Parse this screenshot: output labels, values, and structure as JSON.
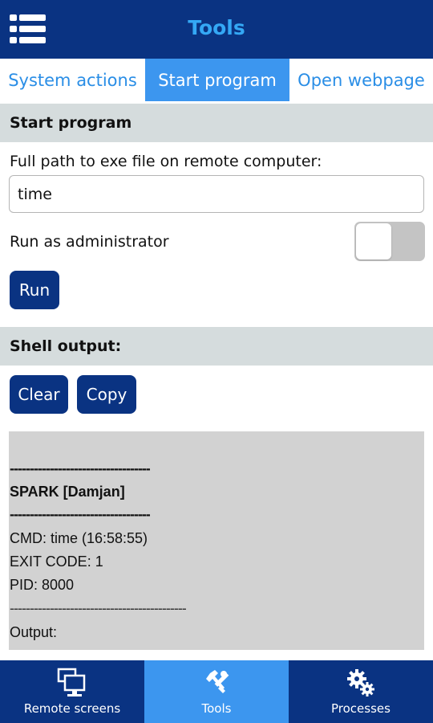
{
  "header": {
    "title": "Tools",
    "menu_icon": "hamburger-list-icon",
    "color": "#0a3382",
    "title_color": "#34a8f5"
  },
  "tabs": [
    {
      "label": "System actions",
      "active": false
    },
    {
      "label": "Start program",
      "active": true
    },
    {
      "label": "Open webpage",
      "active": false
    }
  ],
  "start_program": {
    "section_title": "Start program",
    "path_label": "Full path to exe file on remote computer:",
    "path_value": "time",
    "admin_label": "Run as administrator",
    "admin_enabled": false,
    "run_label": "Run"
  },
  "shell": {
    "section_title": "Shell output:",
    "clear_label": "Clear",
    "copy_label": "Copy",
    "lines": {
      "sep1": "-----------------------------------",
      "host": "SPARK [Damjan]",
      "sep2": "-----------------------------------",
      "cmd": "CMD: time (16:58:55)",
      "exit": "EXIT CODE: 1",
      "pid": "PID: 8000",
      "sep3": "--------------------------------------------",
      "output": "Output:"
    }
  },
  "bottom_nav": [
    {
      "label": "Remote screens",
      "icon": "monitors-icon",
      "active": false
    },
    {
      "label": "Tools",
      "icon": "tools-icon",
      "active": true
    },
    {
      "label": "Processes",
      "icon": "gears-icon",
      "active": false
    }
  ],
  "colors": {
    "primary": "#0a3382",
    "accent": "#3c96ef",
    "section_bg": "#d5dcdd",
    "output_bg": "#d2d2d2"
  }
}
